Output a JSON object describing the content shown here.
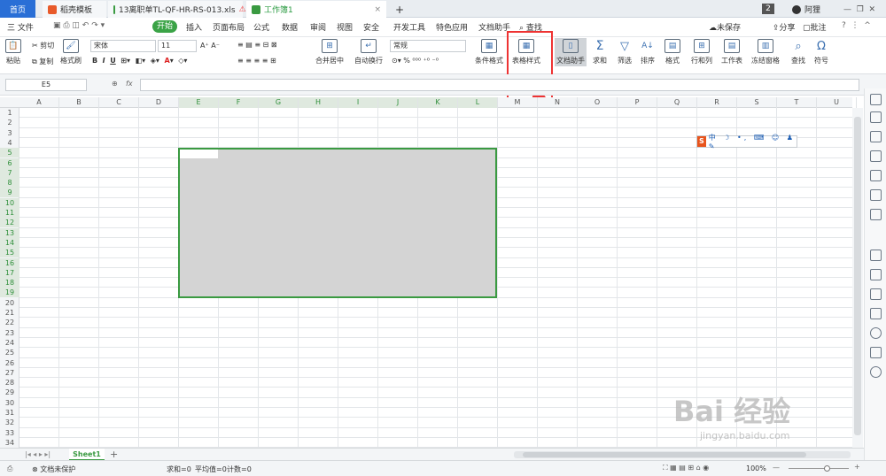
{
  "tabs": {
    "home": "首页",
    "doc1": "稻壳模板",
    "doc2": "13离职单TL-QF-HR-RS-013.xls",
    "doc3": "工作簿1",
    "new_tab": "+",
    "page_count": "2",
    "user": "阿狸"
  },
  "menu": {
    "file": "三 文件",
    "start": "开始",
    "items": [
      "插入",
      "页面布局",
      "公式",
      "数据",
      "审阅",
      "视图",
      "安全",
      "开发工具",
      "特色应用",
      "文档助手"
    ],
    "search": "查找",
    "unsaved": "未保存",
    "share": "分享",
    "comment": "批注"
  },
  "toolbar": {
    "paste": "粘贴",
    "cut": "剪切",
    "copy": "复制",
    "format_painter": "格式刷",
    "font_name": "宋体",
    "font_size": "11",
    "merge_center": "合并居中",
    "auto_wrap": "自动换行",
    "number_format": "常规",
    "cond_format": "条件格式",
    "table_style": "表格样式",
    "doc_helper": "文档助手",
    "sum": "求和",
    "filter": "筛选",
    "sort": "排序",
    "format": "格式",
    "row_col": "行和列",
    "worksheet": "工作表",
    "freeze": "冻结窗格",
    "find": "查找",
    "symbol": "符号"
  },
  "formula": {
    "name_box": "E5",
    "fx": "fx"
  },
  "columns": [
    "A",
    "B",
    "C",
    "D",
    "E",
    "F",
    "G",
    "H",
    "I",
    "J",
    "K",
    "L",
    "M",
    "N",
    "O",
    "P",
    "Q",
    "R",
    "S",
    "T",
    "U"
  ],
  "rows": [
    "1",
    "2",
    "3",
    "4",
    "5",
    "6",
    "7",
    "8",
    "9",
    "10",
    "11",
    "12",
    "13",
    "14",
    "15",
    "16",
    "17",
    "18",
    "19",
    "20",
    "21",
    "22",
    "23",
    "24",
    "25",
    "26",
    "27",
    "28",
    "29",
    "30",
    "31",
    "32",
    "33",
    "34"
  ],
  "sheet": {
    "name": "Sheet1"
  },
  "status": {
    "protect": "文档未保护",
    "sum": "求和=0",
    "avg": "平均值=0",
    "count": "计数=0",
    "zoom": "100%"
  },
  "watermark": {
    "brand": "Bai 经验",
    "url": "jingyan.baidu.com"
  },
  "colors": {
    "accent": "#3a9a41",
    "highlight": "#e33333",
    "selection": "#d4d4d4"
  }
}
